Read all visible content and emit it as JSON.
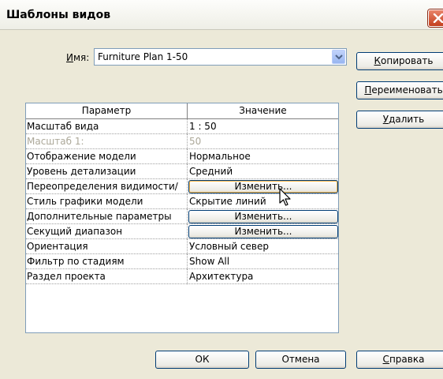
{
  "window": {
    "title": "Шаблоны видов",
    "close_icon": "close-icon"
  },
  "name_field": {
    "label_underlined": "И",
    "label_rest": "мя:",
    "value": "Furniture Plan 1-50"
  },
  "side_buttons": {
    "copy_u": "К",
    "copy_rest": "опировать",
    "rename_u": "П",
    "rename_rest": "ереименовать",
    "delete_u": "У",
    "delete_rest": "далить"
  },
  "table": {
    "headers": [
      "Параметр",
      "Значение"
    ],
    "rows": [
      {
        "param": "Масштаб вида",
        "value": "1 : 50"
      },
      {
        "param": "Масштаб    1:",
        "value": "50"
      },
      {
        "param": "Отображение модели",
        "value": "Нормальное"
      },
      {
        "param": "Уровень детализации",
        "value": "Средний"
      },
      {
        "param": "Переопределения видимости/",
        "value": "Изменить..."
      },
      {
        "param": "Стиль графики модели",
        "value": "Скрытие линий"
      },
      {
        "param": "Дополнительные параметры",
        "value": "Изменить..."
      },
      {
        "param": "Секущий диапазон",
        "value": "Изменить..."
      },
      {
        "param": "Ориентация",
        "value": "Условный север"
      },
      {
        "param": "Фильтр по стадиям",
        "value": "Show All"
      },
      {
        "param": "Раздел проекта",
        "value": "Архитектура"
      }
    ]
  },
  "bottom_buttons": {
    "ok": "ОК",
    "cancel": "Отмена",
    "help_u": "С",
    "help_rest": "правка"
  }
}
